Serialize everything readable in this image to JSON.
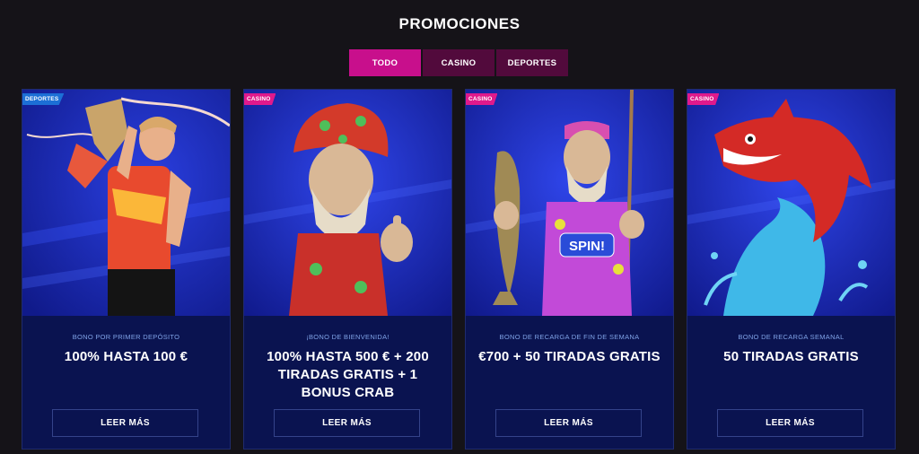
{
  "page": {
    "title": "PROMOCIONES"
  },
  "tabs": [
    {
      "label": "TODO",
      "active": true
    },
    {
      "label": "CASINO",
      "active": false
    },
    {
      "label": "DEPORTES",
      "active": false
    }
  ],
  "colors": {
    "background": "#151318",
    "accent": "#c80f8c",
    "tab_inactive": "#520a3c",
    "card_bg": "#0a1350",
    "badge_casino": "#e0198c",
    "badge_deportes": "#1c6fd6",
    "subtitle_text": "#7fa2e6"
  },
  "cards": [
    {
      "badge": "DEPORTES",
      "image": "footballer-holding-trophy",
      "subtitle": "BONO POR PRIMER DEPÓSITO",
      "headline": "100% HASTA 100 €",
      "button": "LEER MÁS"
    },
    {
      "badge": "CASINO",
      "image": "pirate-thumbs-up",
      "subtitle": "¡BONO DE BIENVENIDA!",
      "headline": "100% HASTA 500 € + 200 TIRADAS GRATIS + 1 BONUS CRAB",
      "button": "LEER MÁS"
    },
    {
      "badge": "CASINO",
      "image": "fisherman-holding-fish",
      "image_text": "SPIN!",
      "subtitle": "BONO DE RECARGA DE FIN DE SEMANA",
      "headline": "€700 + 50 TIRADAS GRATIS",
      "button": "LEER MÁS"
    },
    {
      "badge": "CASINO",
      "image": "red-shark-jumping",
      "subtitle": "BONO DE RECARGA SEMANAL",
      "headline": "50 TIRADAS GRATIS",
      "button": "LEER MÁS"
    }
  ]
}
